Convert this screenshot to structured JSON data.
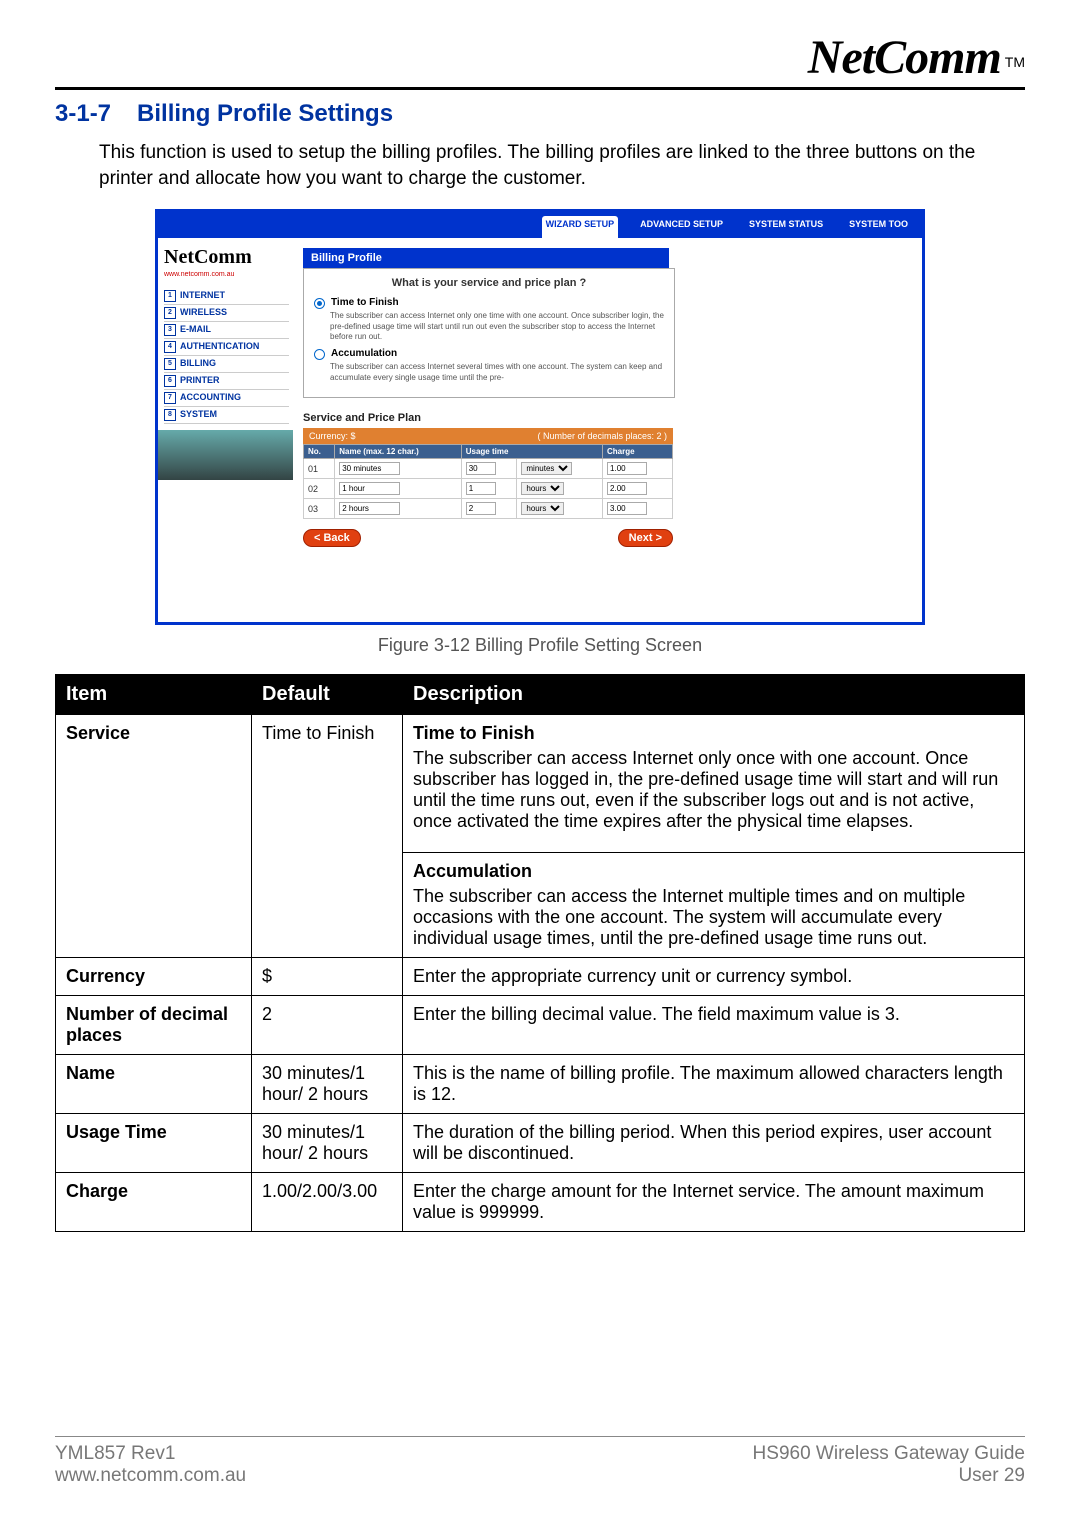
{
  "brand": {
    "name": "NetComm",
    "tm": "TM"
  },
  "heading": {
    "number": "3-1-7",
    "title": "Billing Profile Settings"
  },
  "intro": "This function is used to setup the billing profiles. The billing profiles are linked to the three buttons on the printer and allocate how you want to charge the customer.",
  "screenshot": {
    "tabs": {
      "wizard": "WIZARD SETUP",
      "advanced": "ADVANCED SETUP",
      "status": "SYSTEM STATUS",
      "tool": "SYSTEM TOO"
    },
    "logo": "NetComm",
    "logo_sub": "www.netcomm.com.au",
    "nav": [
      {
        "num": "1",
        "label": "INTERNET"
      },
      {
        "num": "2",
        "label": "WIRELESS"
      },
      {
        "num": "3",
        "label": "E-MAIL"
      },
      {
        "num": "4",
        "label": "AUTHENTICATION"
      },
      {
        "num": "5",
        "label": "BILLING"
      },
      {
        "num": "6",
        "label": "PRINTER"
      },
      {
        "num": "7",
        "label": "ACCOUNTING"
      },
      {
        "num": "8",
        "label": "SYSTEM"
      }
    ],
    "panel_title": "Billing Profile",
    "question": "What is your service and price plan ?",
    "opt1": {
      "label": "Time to Finish",
      "desc": "The subscriber can access Internet only one time with one account. Once subscriber login, the pre-defined usage time will start until run out even the subscriber stop to access the Internet before run out."
    },
    "opt2": {
      "label": "Accumulation",
      "desc": "The subscriber can access Internet several times with one account. The system can keep and accumulate every single usage time until the pre-"
    },
    "subtitle": "Service and Price Plan",
    "orange": {
      "left": "Currency: $",
      "right": "( Number of decimals places: 2          )"
    },
    "th": {
      "no": "No.",
      "name": "Name (max. 12 char.)",
      "usage": "Usage time",
      "charge": "Charge"
    },
    "rows": [
      {
        "no": "01",
        "name": "30 minutes",
        "val": "30",
        "unit": "minutes",
        "charge": "1.00"
      },
      {
        "no": "02",
        "name": "1 hour",
        "val": "1",
        "unit": "hours",
        "charge": "2.00"
      },
      {
        "no": "03",
        "name": "2 hours",
        "val": "2",
        "unit": "hours",
        "charge": "3.00"
      }
    ],
    "back": "< Back",
    "next": "Next >"
  },
  "figure_caption": "Figure 3-12 Billing Proﬁle Setting Screen",
  "table": {
    "head": {
      "item": "Item",
      "default": "Default",
      "desc": "Description"
    },
    "rows": {
      "service": {
        "item": "Service",
        "def": "Time to Finish",
        "d1h": "Time to Finish",
        "d1": "The subscriber can access Internet only once with one account. Once subscriber has logged in, the pre-defined usage time will start and will run until the time runs out, even if the subscriber logs out and is not active, once activated the time expires after the physical time elapses.",
        "d2h": "Accumulation",
        "d2": "The subscriber can access the Internet multiple times and on multiple occasions with the one account. The system will accumulate every individual usage times, until the pre-defined usage time runs out."
      },
      "currency": {
        "item": "Currency",
        "def": "$",
        "desc": "Enter the appropriate currency unit or currency symbol."
      },
      "decimals": {
        "item": "Number of decimal places",
        "def": "2",
        "desc": "Enter the billing decimal value. The field maximum value is 3."
      },
      "name": {
        "item": "Name",
        "def": "30 minutes/1 hour/ 2 hours",
        "desc": "This is the name of billing profile. The maximum allowed characters length is 12."
      },
      "usage": {
        "item": "Usage Time",
        "def": "30 minutes/1 hour/ 2 hours",
        "desc": "The duration of the billing period. When this period expires, user account will be discontinued."
      },
      "charge": {
        "item": "Charge",
        "def": "1.00/2.00/3.00",
        "desc": "Enter the charge amount for the Internet service. The amount maximum value is 999999."
      }
    }
  },
  "footer": {
    "left1": "YML857 Rev1",
    "left2": "www.netcomm.com.au",
    "right1": "HS960 Wireless Gateway Guide",
    "right2_a": "User",
    "right2_b": "29"
  }
}
